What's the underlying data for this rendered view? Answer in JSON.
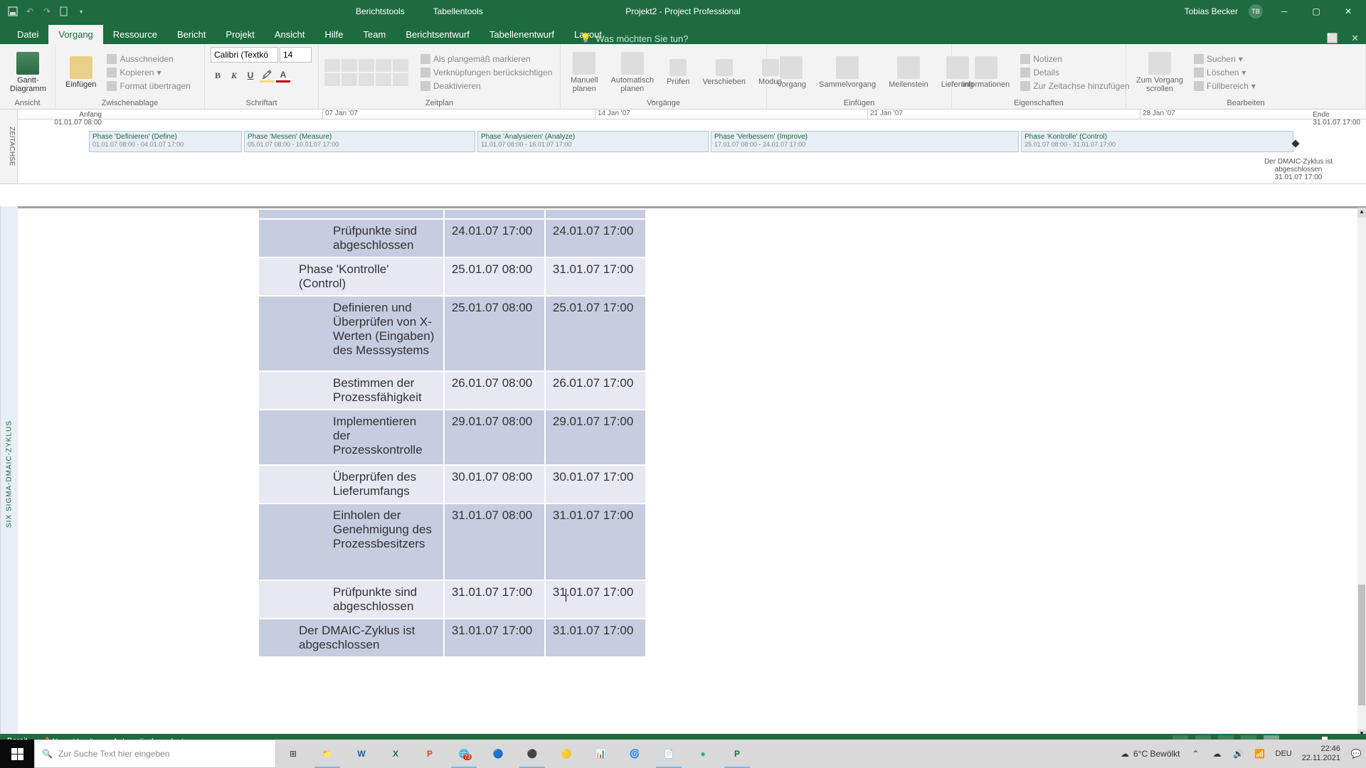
{
  "titlebar": {
    "tool_tab1": "Berichtstools",
    "tool_tab2": "Tabellentools",
    "app_title": "Projekt2  -  Project Professional",
    "user_name": "Tobias Becker",
    "user_initials": "TB"
  },
  "ribbon_tabs": [
    "Datei",
    "Vorgang",
    "Ressource",
    "Bericht",
    "Projekt",
    "Ansicht",
    "Hilfe",
    "Team",
    "Berichtsentwurf",
    "Tabellenentwurf",
    "Layout"
  ],
  "active_tab_index": 1,
  "tell_me": "Was möchten Sie tun?",
  "ribbon": {
    "ansicht_label": "Ansicht",
    "gantt_btn": "Gantt-\nDiagramm",
    "zwischenablage_label": "Zwischenablage",
    "einfuegen_btn": "Einfügen",
    "ausschneiden": "Ausschneiden",
    "kopieren": "Kopieren",
    "format_uebertragen": "Format übertragen",
    "schriftart_label": "Schriftart",
    "font_name": "Calibri (Textkö",
    "font_size": "14",
    "zeitplan_label": "Zeitplan",
    "als_plangemass": "Als plangemäß markieren",
    "verknuepfungen": "Verknüpfungen berücksichtigen",
    "deaktivieren": "Deaktivieren",
    "vorgaenge_label": "Vorgänge",
    "manuell_planen": "Manuell\nplanen",
    "automatisch_planen": "Automatisch\nplanen",
    "pruefen": "Prüfen",
    "verschieben": "Verschieben",
    "modus": "Modus",
    "einfuegen_label": "Einfügen",
    "vorgang": "Vorgang",
    "sammelvorgang": "Sammelvorgang",
    "meilenstein": "Meilenstein",
    "lieferung": "Lieferung",
    "eigenschaften_label": "Eigenschaften",
    "informationen": "Informationen",
    "notizen": "Notizen",
    "details": "Details",
    "zur_zeitachse": "Zur Zeitachse hinzufügen",
    "bearbeiten_label": "Bearbeiten",
    "zum_vorgang": "Zum Vorgang\nscrollen",
    "suchen": "Suchen",
    "loeschen": "Löschen",
    "fuellbereich": "Füllbereich"
  },
  "timeline": {
    "side_label": "ZEITACHSE",
    "anfang_label": "Anfang",
    "anfang_date": "01.01.07 08:00",
    "ende_label": "Ende",
    "ende_date": "31.01.07 17:00",
    "ticks": [
      "07 Jan '07",
      "14 Jan '07",
      "21 Jan '07",
      "28 Jan '07"
    ],
    "phases": [
      {
        "name": "Phase 'Definieren' (Define)",
        "dates": "01.01.07 08:00 - 04.01.07 17:00"
      },
      {
        "name": "Phase 'Messen' (Measure)",
        "dates": "05.01.07 08:00 - 10.01.07 17:00"
      },
      {
        "name": "Phase 'Analysieren' (Analyze)",
        "dates": "11.01.07 08:00 - 16.01.07 17:00"
      },
      {
        "name": "Phase 'Verbessern' (Improve)",
        "dates": "17.01.07 08:00 - 24.01.07 17:00"
      },
      {
        "name": "Phase 'Kontrolle' (Control)",
        "dates": "25.01.07 08:00 - 31.01.07 17:00"
      }
    ],
    "milestone_text": "Der DMAIC-Zyklus ist\nabgeschlossen",
    "milestone_date": "31.01.07 17:00"
  },
  "side_label": "SIX SIGMA-DMAIC-ZYKLUS",
  "table_rows": [
    {
      "alt": true,
      "indent": 2,
      "task": "Prüfpunkte sind abgeschlossen",
      "start": "24.01.07 17:00",
      "end": "24.01.07 17:00"
    },
    {
      "alt": false,
      "indent": 1,
      "task": "Phase 'Kontrolle' (Control)",
      "start": "25.01.07 08:00",
      "end": "31.01.07 17:00"
    },
    {
      "alt": true,
      "indent": 2,
      "task": "Definieren und Überprüfen von X-Werten (Eingaben) des Messsystems",
      "start": "25.01.07 08:00",
      "end": "25.01.07 17:00"
    },
    {
      "alt": false,
      "indent": 2,
      "task": "Bestimmen der Prozessfähigkeit",
      "start": "26.01.07 08:00",
      "end": "26.01.07 17:00"
    },
    {
      "alt": true,
      "indent": 2,
      "task": "Implementieren der Prozesskontrolle",
      "start": "29.01.07 08:00",
      "end": "29.01.07 17:00"
    },
    {
      "alt": false,
      "indent": 2,
      "task": "Überprüfen des Lieferumfangs",
      "start": "30.01.07 08:00",
      "end": "30.01.07 17:00"
    },
    {
      "alt": true,
      "indent": 2,
      "task": "Einholen der Genehmigung des Prozessbesitzers",
      "start": "31.01.07 08:00",
      "end": "31.01.07 17:00"
    },
    {
      "alt": false,
      "indent": 2,
      "task": "Prüfpunkte sind abgeschlossen",
      "start": "31.01.07 17:00",
      "end": "31.01.07 17:00"
    },
    {
      "alt": true,
      "indent": 1,
      "task": "Der DMAIC-Zyklus ist abgeschlossen",
      "start": "31.01.07 17:00",
      "end": "31.01.07 17:00"
    }
  ],
  "status": {
    "ready": "Bereit",
    "new_tasks": "Neue Vorgänge : Automatisch geplant"
  },
  "taskbar": {
    "search_placeholder": "Zur Suche Text hier eingeben",
    "weather_text": "6°C  Bewölkt",
    "lang": "DEU",
    "time": "22:46",
    "date": "22.11.2021",
    "chrome_badge": "73"
  }
}
